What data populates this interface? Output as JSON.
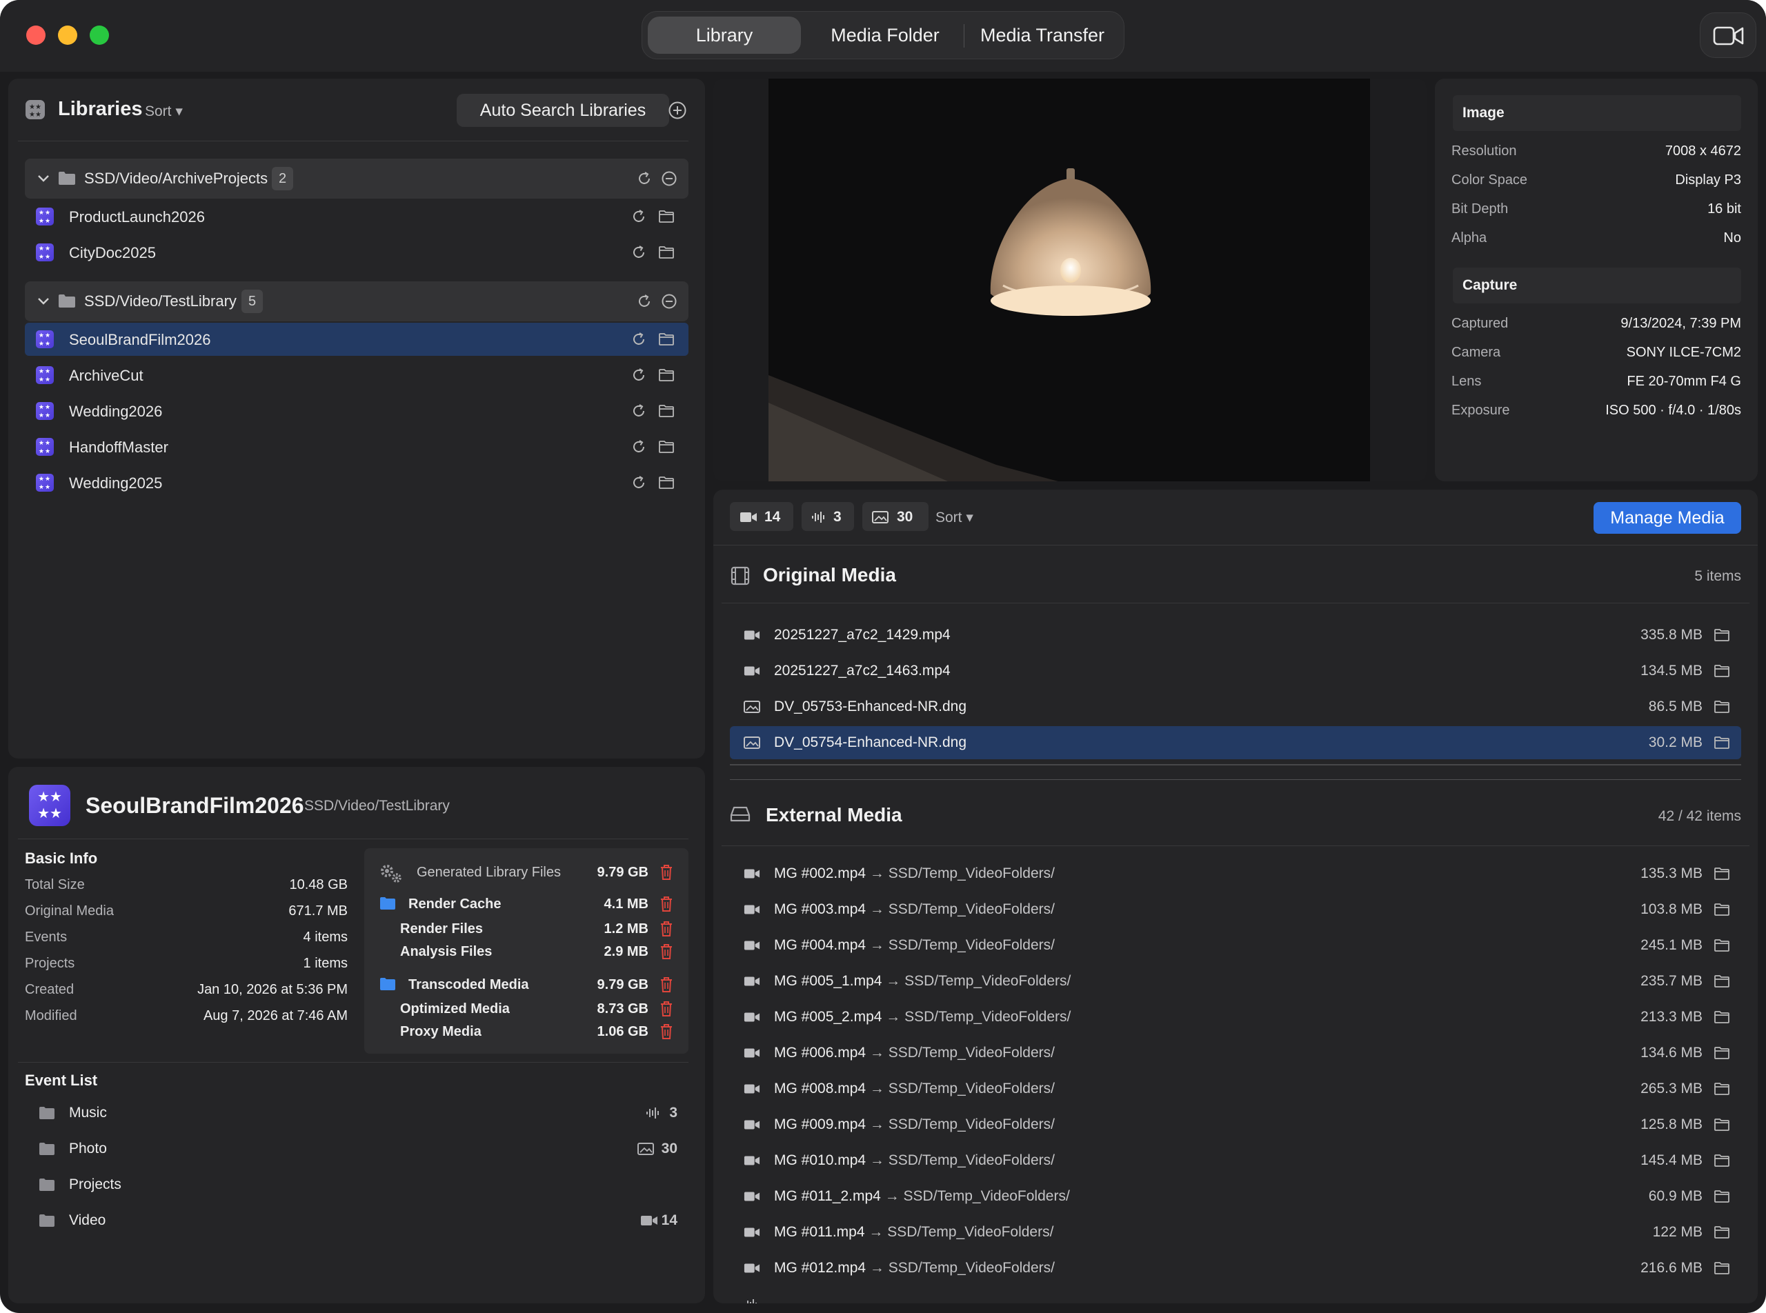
{
  "toolbar": {
    "tabs": [
      "Library",
      "Media Folder",
      "Media Transfer"
    ],
    "active_tab": "Library"
  },
  "libraries": {
    "title": "Libraries",
    "sort_label": "Sort ▾",
    "auto_search_label": "Auto Search Libraries",
    "groups": [
      {
        "path": "SSD/Video/ArchiveProjects",
        "count": "2",
        "items": [
          "ProductLaunch2026",
          "CityDoc2025"
        ]
      },
      {
        "path": "SSD/Video/TestLibrary",
        "count": "5",
        "items": [
          "SeoulBrandFilm2026",
          "ArchiveCut",
          "Wedding2026",
          "HandoffMaster",
          "Wedding2025"
        ]
      }
    ],
    "selected": "SeoulBrandFilm2026"
  },
  "image_info": {
    "image_header": "Image",
    "image_rows": [
      {
        "k": "Resolution",
        "v": "7008 x 4672"
      },
      {
        "k": "Color Space",
        "v": "Display P3"
      },
      {
        "k": "Bit Depth",
        "v": "16 bit"
      },
      {
        "k": "Alpha",
        "v": "No"
      }
    ],
    "capture_header": "Capture",
    "capture_rows": [
      {
        "k": "Captured",
        "v": "9/13/2024, 7:39 PM"
      },
      {
        "k": "Camera",
        "v": "SONY ILCE-7CM2"
      },
      {
        "k": "Lens",
        "v": "FE 20-70mm F4 G"
      },
      {
        "k": "Exposure",
        "v": "ISO 500 · f/4.0 · 1/80s"
      }
    ]
  },
  "media": {
    "video_count": "14",
    "audio_count": "3",
    "photo_count": "30",
    "sort_label": "Sort ▾",
    "manage_label": "Manage Media",
    "original_title": "Original Media",
    "original_count": "5 items",
    "original_files": [
      {
        "name": "20251227_a7c2_1429.mp4",
        "size": "335.8 MB",
        "kind": "video"
      },
      {
        "name": "20251227_a7c2_1463.mp4",
        "size": "134.5 MB",
        "kind": "video"
      },
      {
        "name": "DV_05753-Enhanced-NR.dng",
        "size": "86.5 MB",
        "kind": "image"
      },
      {
        "name": "DV_05754-Enhanced-NR.dng",
        "size": "30.2 MB",
        "kind": "image"
      }
    ],
    "original_selected": "DV_05754-Enhanced-NR.dng",
    "external_title": "External Media",
    "external_count": "42 / 42 items",
    "external_files": [
      {
        "name": "MG #002.mp4",
        "path": "SSD/Temp_VideoFolders/",
        "size": "135.3 MB"
      },
      {
        "name": "MG #003.mp4",
        "path": "SSD/Temp_VideoFolders/",
        "size": "103.8 MB"
      },
      {
        "name": "MG #004.mp4",
        "path": "SSD/Temp_VideoFolders/",
        "size": "245.1 MB"
      },
      {
        "name": "MG #005_1.mp4",
        "path": "SSD/Temp_VideoFolders/",
        "size": "235.7 MB"
      },
      {
        "name": "MG #005_2.mp4",
        "path": "SSD/Temp_VideoFolders/",
        "size": "213.3 MB"
      },
      {
        "name": "MG #006.mp4",
        "path": "SSD/Temp_VideoFolders/",
        "size": "134.6 MB"
      },
      {
        "name": "MG #008.mp4",
        "path": "SSD/Temp_VideoFolders/",
        "size": "265.3 MB"
      },
      {
        "name": "MG #009.mp4",
        "path": "SSD/Temp_VideoFolders/",
        "size": "125.8 MB"
      },
      {
        "name": "MG #010.mp4",
        "path": "SSD/Temp_VideoFolders/",
        "size": "145.4 MB"
      },
      {
        "name": "MG #011_2.mp4",
        "path": "SSD/Temp_VideoFolders/",
        "size": "60.9 MB"
      },
      {
        "name": "MG #011.mp4",
        "path": "SSD/Temp_VideoFolders/",
        "size": "122 MB"
      },
      {
        "name": "MG #012.mp4",
        "path": "SSD/Temp_VideoFolders/",
        "size": "216.6 MB"
      }
    ]
  },
  "detail": {
    "name": "SeoulBrandFilm2026",
    "path": "SSD/Video/TestLibrary",
    "basic_info_title": "Basic Info",
    "basic_rows": [
      {
        "k": "Total Size",
        "v": "10.48 GB"
      },
      {
        "k": "Original Media",
        "v": "671.7 MB"
      },
      {
        "k": "Events",
        "v": "4 items"
      },
      {
        "k": "Projects",
        "v": "1 items"
      },
      {
        "k": "Created",
        "v": "Jan 10, 2026 at 5:36 PM"
      },
      {
        "k": "Modified",
        "v": "Aug 7, 2026 at 7:46 AM"
      }
    ],
    "generated": {
      "title": "Generated Library Files",
      "total": "9.79 GB",
      "render_cache": "Render Cache",
      "render_cache_size": "4.1 MB",
      "render_files": "Render Files",
      "render_files_size": "1.2 MB",
      "analysis_files": "Analysis Files",
      "analysis_files_size": "2.9 MB",
      "transcoded": "Transcoded Media",
      "transcoded_size": "9.79 GB",
      "optimized": "Optimized Media",
      "optimized_size": "8.73 GB",
      "proxy": "Proxy Media",
      "proxy_size": "1.06 GB"
    },
    "event_list_title": "Event List",
    "events": [
      {
        "name": "Music",
        "count": "3",
        "kind": "audio"
      },
      {
        "name": "Photo",
        "count": "30",
        "kind": "image"
      },
      {
        "name": "Projects",
        "count": "",
        "kind": ""
      },
      {
        "name": "Video",
        "count": "14",
        "kind": "video"
      }
    ]
  },
  "colors": {
    "accent": "#2d6fe0",
    "selection": "#233a63",
    "library_icon": "#5b48e6",
    "delete": "#e0453c",
    "folder_blue": "#3d8bf0"
  }
}
